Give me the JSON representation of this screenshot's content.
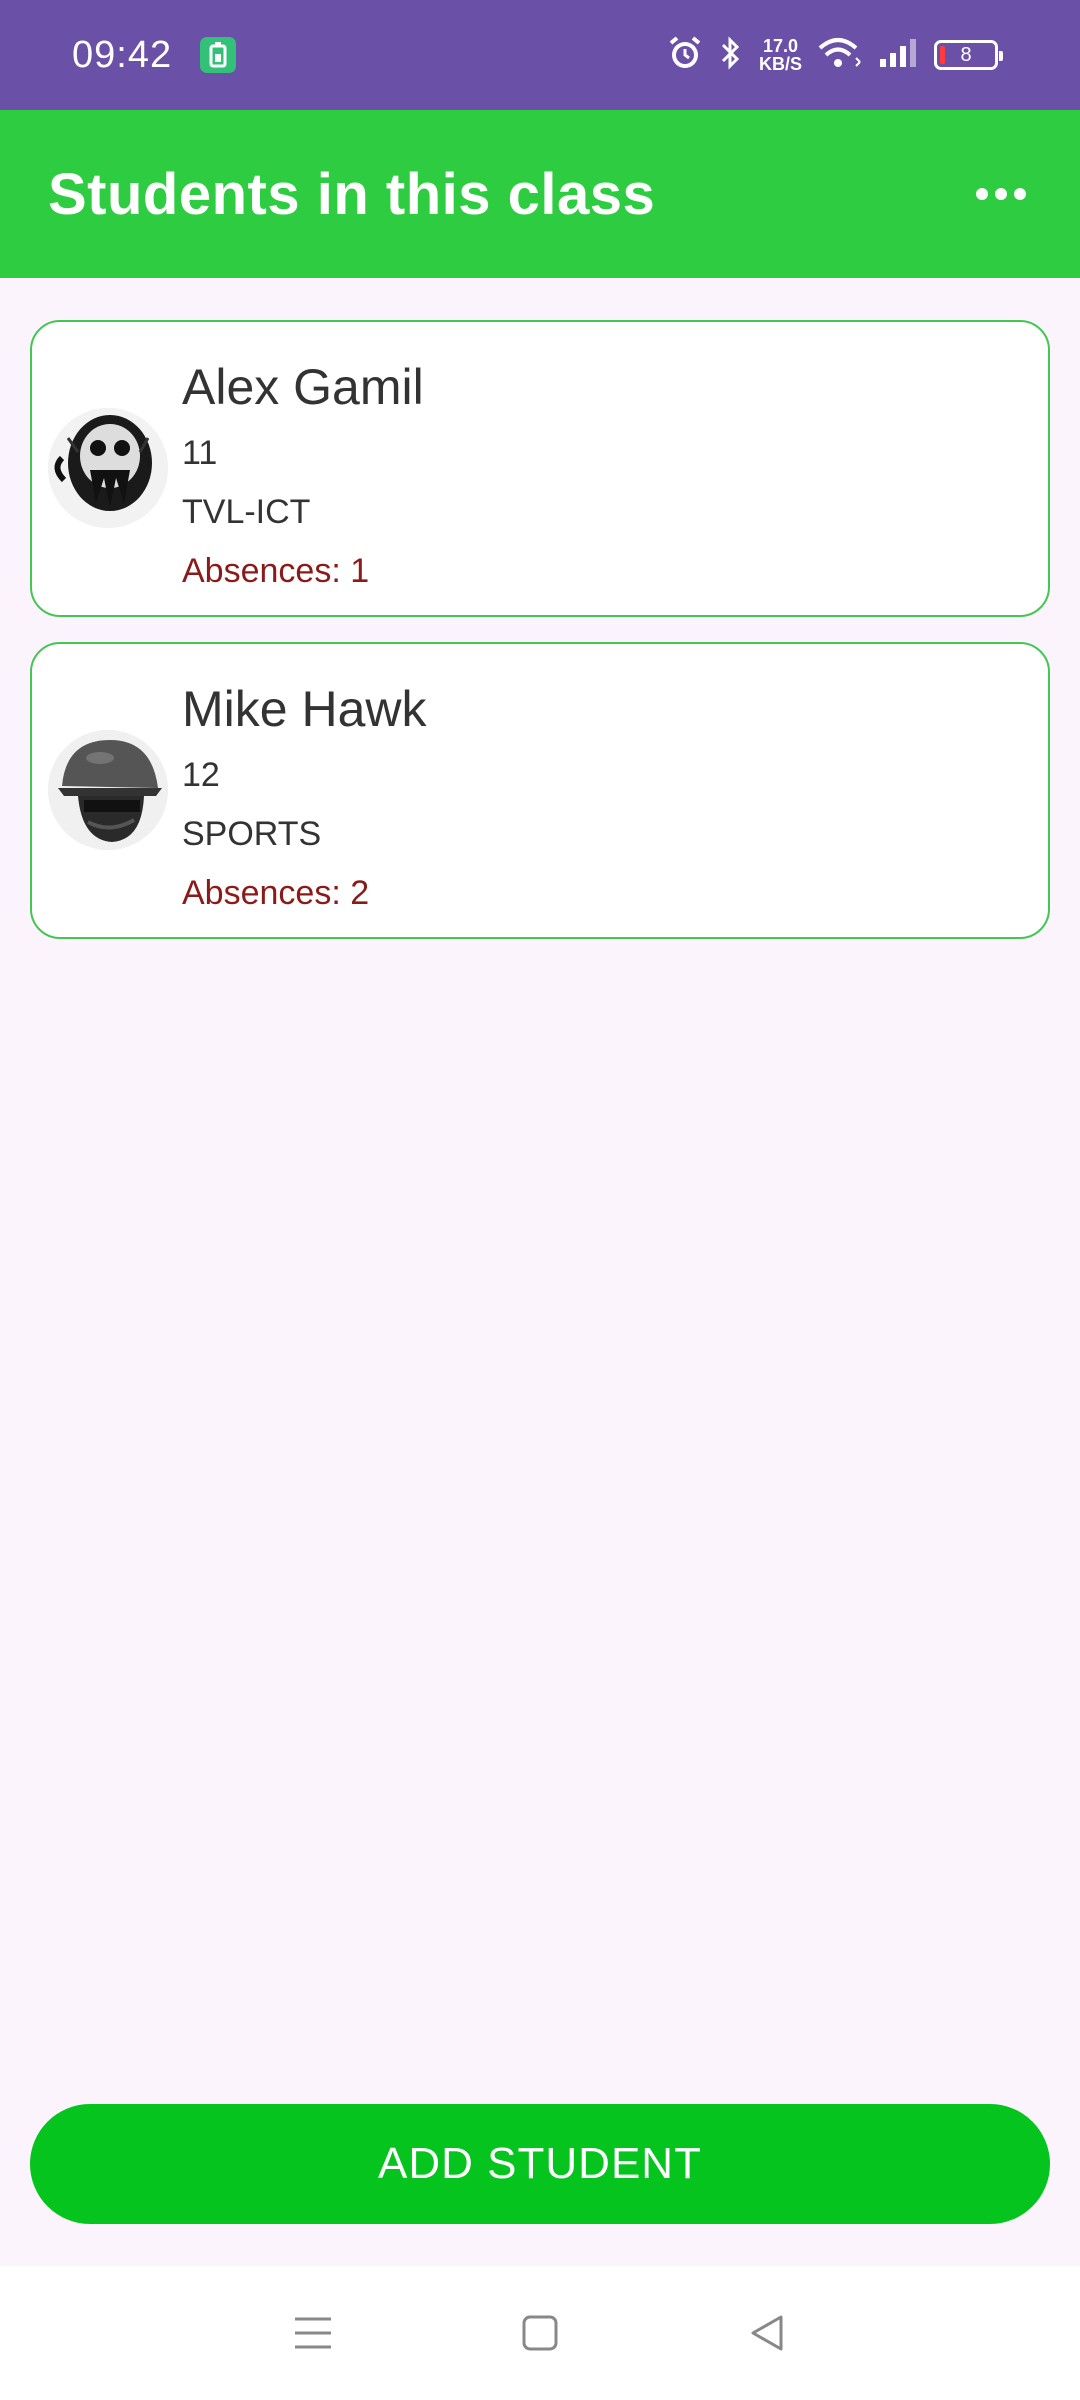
{
  "status_bar": {
    "time": "09:42",
    "net_speed_value": "17.0",
    "net_speed_unit": "KB/S",
    "battery_level": "8"
  },
  "app_bar": {
    "title": "Students in this class",
    "more_icon": "more-horizontal-icon"
  },
  "students": [
    {
      "name": "Alex Gamil",
      "grade": "11",
      "strand": "TVL-ICT",
      "absences": "Absences: 1"
    },
    {
      "name": "Mike Hawk",
      "grade": "12",
      "strand": "SPORTS",
      "absences": "Absences: 2"
    }
  ],
  "actions": {
    "add_student_label": "ADD STUDENT"
  },
  "colors": {
    "status_bar": "#6a50a6",
    "app_bar": "#2ecc40",
    "card_border": "#43c751",
    "absences_text": "#8b1a1a",
    "button": "#06c41e",
    "background": "#fcf4fd"
  }
}
